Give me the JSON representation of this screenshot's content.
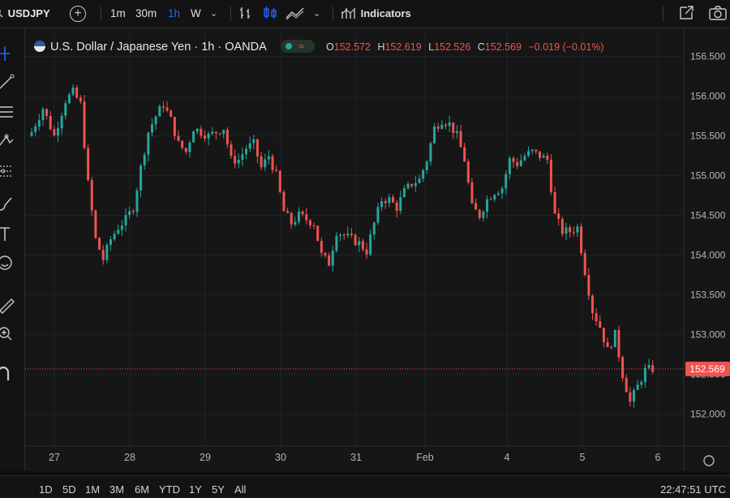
{
  "header": {
    "symbol": "USDJPY",
    "timeframes": [
      "1m",
      "30m",
      "1h",
      "W"
    ],
    "active_timeframe": "1h",
    "indicators_label": "Indicators",
    "icons": [
      "search-icon",
      "add-symbol-icon",
      "chevron-down-icon",
      "bar-style-icon",
      "candle-style-icon",
      "area-style-icon",
      "chevron-down-icon",
      "indicators-icon",
      "fullscreen-icon",
      "camera-icon"
    ]
  },
  "legend": {
    "title": "U.S. Dollar / Japanese Yen · 1h · OANDA",
    "open_label": "O",
    "open": "152.572",
    "high_label": "H",
    "high": "152.619",
    "low_label": "L",
    "low": "152.526",
    "close_label": "C",
    "close": "152.569",
    "change": "−0.019 (−0.01%)"
  },
  "price_axis": {
    "ticks": [
      "156.500",
      "156.000",
      "155.500",
      "155.000",
      "154.500",
      "154.000",
      "153.500",
      "153.000",
      "152.500",
      "152.000"
    ],
    "current_price_label": "152.569"
  },
  "time_axis": {
    "ticks": [
      "27",
      "28",
      "29",
      "30",
      "31",
      "Feb",
      "4",
      "5",
      "6"
    ]
  },
  "bottom": {
    "ranges": [
      "1D",
      "5D",
      "1M",
      "3M",
      "6M",
      "YTD",
      "1Y",
      "5Y",
      "All"
    ],
    "clock": "22:47:51 UTC"
  },
  "colors": {
    "up": "#26a69a",
    "down": "#ef5350",
    "accent": "#2962ff",
    "price_line": "#ef5350"
  },
  "chart_data": {
    "type": "candlestick",
    "instrument": "USDJPY",
    "interval": "1h",
    "ylim": [
      151.7,
      156.7
    ],
    "x_ticks": [
      "27",
      "28",
      "29",
      "30",
      "31",
      "Feb",
      "4",
      "5",
      "6"
    ],
    "y_ticks": [
      156.5,
      156.0,
      155.5,
      155.0,
      154.5,
      154.0,
      153.5,
      153.0,
      152.5,
      152.0
    ],
    "last_price": 152.569,
    "close_path": [
      [
        0,
        155.55
      ],
      [
        3,
        155.85
      ],
      [
        6,
        155.5
      ],
      [
        9,
        155.95
      ],
      [
        11,
        156.05
      ],
      [
        13,
        155.9
      ],
      [
        15,
        154.9
      ],
      [
        17,
        154.2
      ],
      [
        19,
        153.95
      ],
      [
        21,
        154.2
      ],
      [
        23,
        154.35
      ],
      [
        25,
        154.45
      ],
      [
        27,
        154.6
      ],
      [
        29,
        155.1
      ],
      [
        31,
        155.55
      ],
      [
        33,
        155.75
      ],
      [
        35,
        155.9
      ],
      [
        37,
        155.7
      ],
      [
        39,
        155.4
      ],
      [
        41,
        155.3
      ],
      [
        43,
        155.6
      ],
      [
        45,
        155.55
      ],
      [
        47,
        155.5
      ],
      [
        49,
        155.55
      ],
      [
        51,
        155.6
      ],
      [
        53,
        155.2
      ],
      [
        55,
        155.2
      ],
      [
        57,
        155.35
      ],
      [
        59,
        155.4
      ],
      [
        61,
        155.1
      ],
      [
        63,
        155.25
      ],
      [
        65,
        155.0
      ],
      [
        67,
        154.55
      ],
      [
        69,
        154.4
      ],
      [
        71,
        154.5
      ],
      [
        73,
        154.45
      ],
      [
        75,
        154.4
      ],
      [
        77,
        154.0
      ],
      [
        79,
        153.9
      ],
      [
        81,
        154.3
      ],
      [
        83,
        154.25
      ],
      [
        85,
        154.2
      ],
      [
        87,
        154.15
      ],
      [
        89,
        154.05
      ],
      [
        91,
        154.4
      ],
      [
        93,
        154.7
      ],
      [
        95,
        154.7
      ],
      [
        97,
        154.6
      ],
      [
        99,
        154.8
      ],
      [
        101,
        154.9
      ],
      [
        103,
        154.95
      ],
      [
        105,
        155.2
      ],
      [
        107,
        155.6
      ],
      [
        109,
        155.7
      ],
      [
        111,
        155.65
      ],
      [
        113,
        155.5
      ],
      [
        115,
        155.2
      ],
      [
        117,
        154.6
      ],
      [
        119,
        154.5
      ],
      [
        121,
        154.7
      ],
      [
        123,
        154.8
      ],
      [
        125,
        154.85
      ],
      [
        127,
        155.2
      ],
      [
        129,
        155.15
      ],
      [
        131,
        155.25
      ],
      [
        133,
        155.3
      ],
      [
        135,
        155.25
      ],
      [
        137,
        155.2
      ],
      [
        139,
        154.5
      ],
      [
        141,
        154.3
      ],
      [
        143,
        154.3
      ],
      [
        145,
        154.35
      ],
      [
        147,
        153.8
      ],
      [
        149,
        153.3
      ],
      [
        151,
        153.1
      ],
      [
        153,
        152.8
      ],
      [
        155,
        153.0
      ],
      [
        157,
        152.5
      ],
      [
        159,
        152.15
      ],
      [
        161,
        152.35
      ],
      [
        163,
        152.55
      ],
      [
        165,
        152.57
      ]
    ]
  }
}
